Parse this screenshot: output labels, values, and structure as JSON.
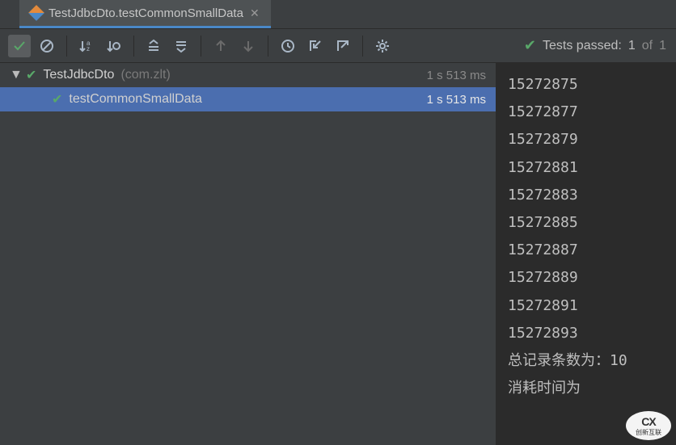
{
  "tab": {
    "title": "TestJdbcDto.testCommonSmallData"
  },
  "status": {
    "prefix": "Tests passed:",
    "count": "1",
    "of": "of",
    "total": "1"
  },
  "tree": {
    "root": {
      "name": "TestJdbcDto",
      "package": "(com.zlt)",
      "time": "1 s 513 ms"
    },
    "child": {
      "name": "testCommonSmallData",
      "time": "1 s 513 ms"
    }
  },
  "console_lines": [
    "15272875",
    "15272877",
    "15272879",
    "15272881",
    "15272883",
    "15272885",
    "15272887",
    "15272889",
    "15272891",
    "15272893",
    "总记录条数为：10",
    "消耗时间为"
  ],
  "watermark": {
    "text1": "CX",
    "text2": "创新互联"
  }
}
